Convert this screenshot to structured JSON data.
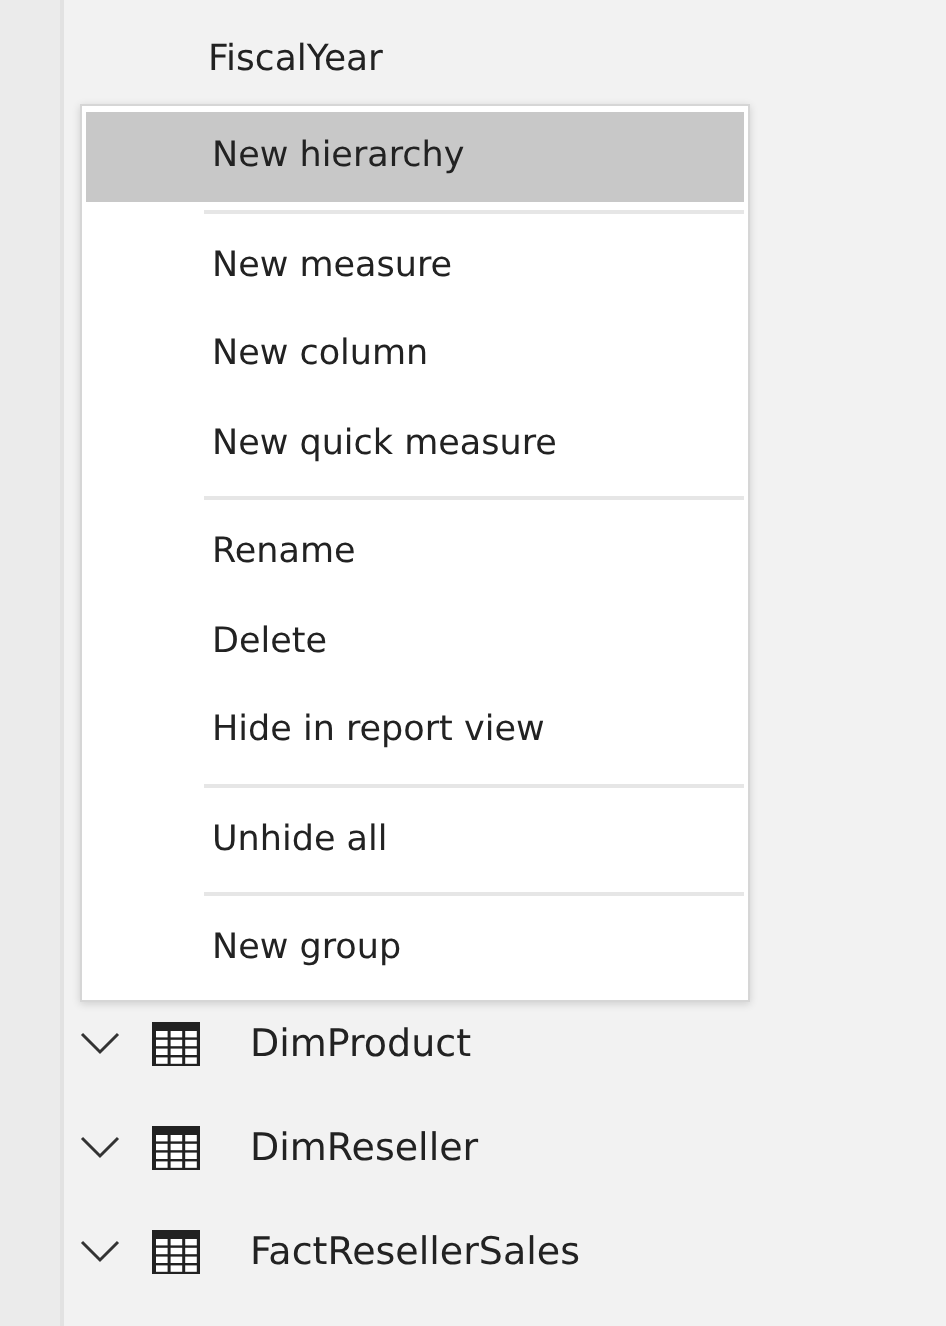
{
  "field": {
    "label": "FiscalYear"
  },
  "context_menu": {
    "groups": [
      [
        {
          "label": "New hierarchy",
          "selected": true
        }
      ],
      [
        {
          "label": "New measure",
          "selected": false
        },
        {
          "label": "New column",
          "selected": false
        },
        {
          "label": "New quick measure",
          "selected": false
        }
      ],
      [
        {
          "label": "Rename",
          "selected": false
        },
        {
          "label": "Delete",
          "selected": false
        },
        {
          "label": "Hide in report view",
          "selected": false
        }
      ],
      [
        {
          "label": "Unhide all",
          "selected": false
        }
      ],
      [
        {
          "label": "New group",
          "selected": false
        }
      ]
    ]
  },
  "tables": [
    {
      "name": "DimProduct",
      "expanded": true
    },
    {
      "name": "DimReseller",
      "expanded": true
    },
    {
      "name": "FactResellerSales",
      "expanded": true
    }
  ]
}
